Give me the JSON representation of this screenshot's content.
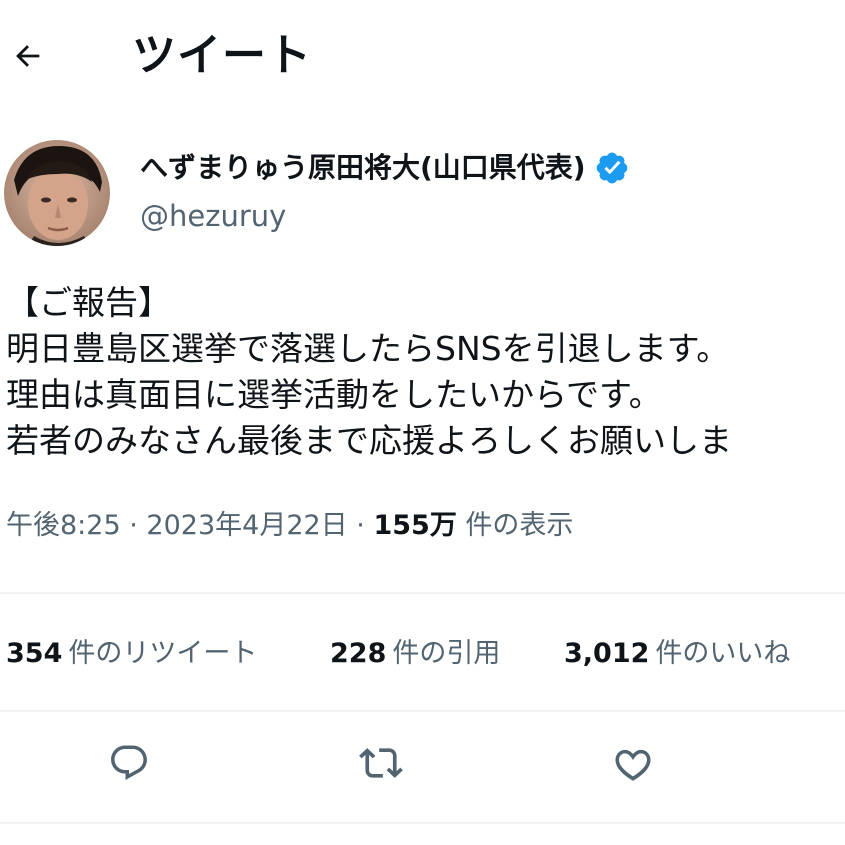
{
  "header": {
    "title": "ツイート",
    "back_icon": "arrow-left-icon"
  },
  "author": {
    "display_name": "へずまりゅう原田将大(山口県代表)",
    "handle": "@hezuruy",
    "verified_color": "#1d9bf0",
    "avatar_icon": "profile-photo"
  },
  "tweet": {
    "lines": [
      "【ご報告】",
      "明日豊島区選挙で落選したらSNSを引退します。",
      "理由は真面目に選挙活動をしたいからです。",
      "若者のみなさん最後まで応援よろしくお願いしま"
    ]
  },
  "meta": {
    "time": "午後8:25",
    "separator": "·",
    "date": "2023年4月22日",
    "views_num": "155万",
    "views_label": "件の表示"
  },
  "stats": {
    "retweets_num": "354",
    "retweets_label": "件のリツイート",
    "quotes_num": "228",
    "quotes_label": "件の引用",
    "likes_num": "3,012",
    "likes_label": "件のいいね"
  },
  "actions": {
    "reply_icon": "reply-icon",
    "retweet_icon": "retweet-icon",
    "like_icon": "heart-icon"
  },
  "colors": {
    "text": "#0f1419",
    "secondary": "#536471",
    "divider": "#eff3f4",
    "accent": "#1d9bf0"
  }
}
